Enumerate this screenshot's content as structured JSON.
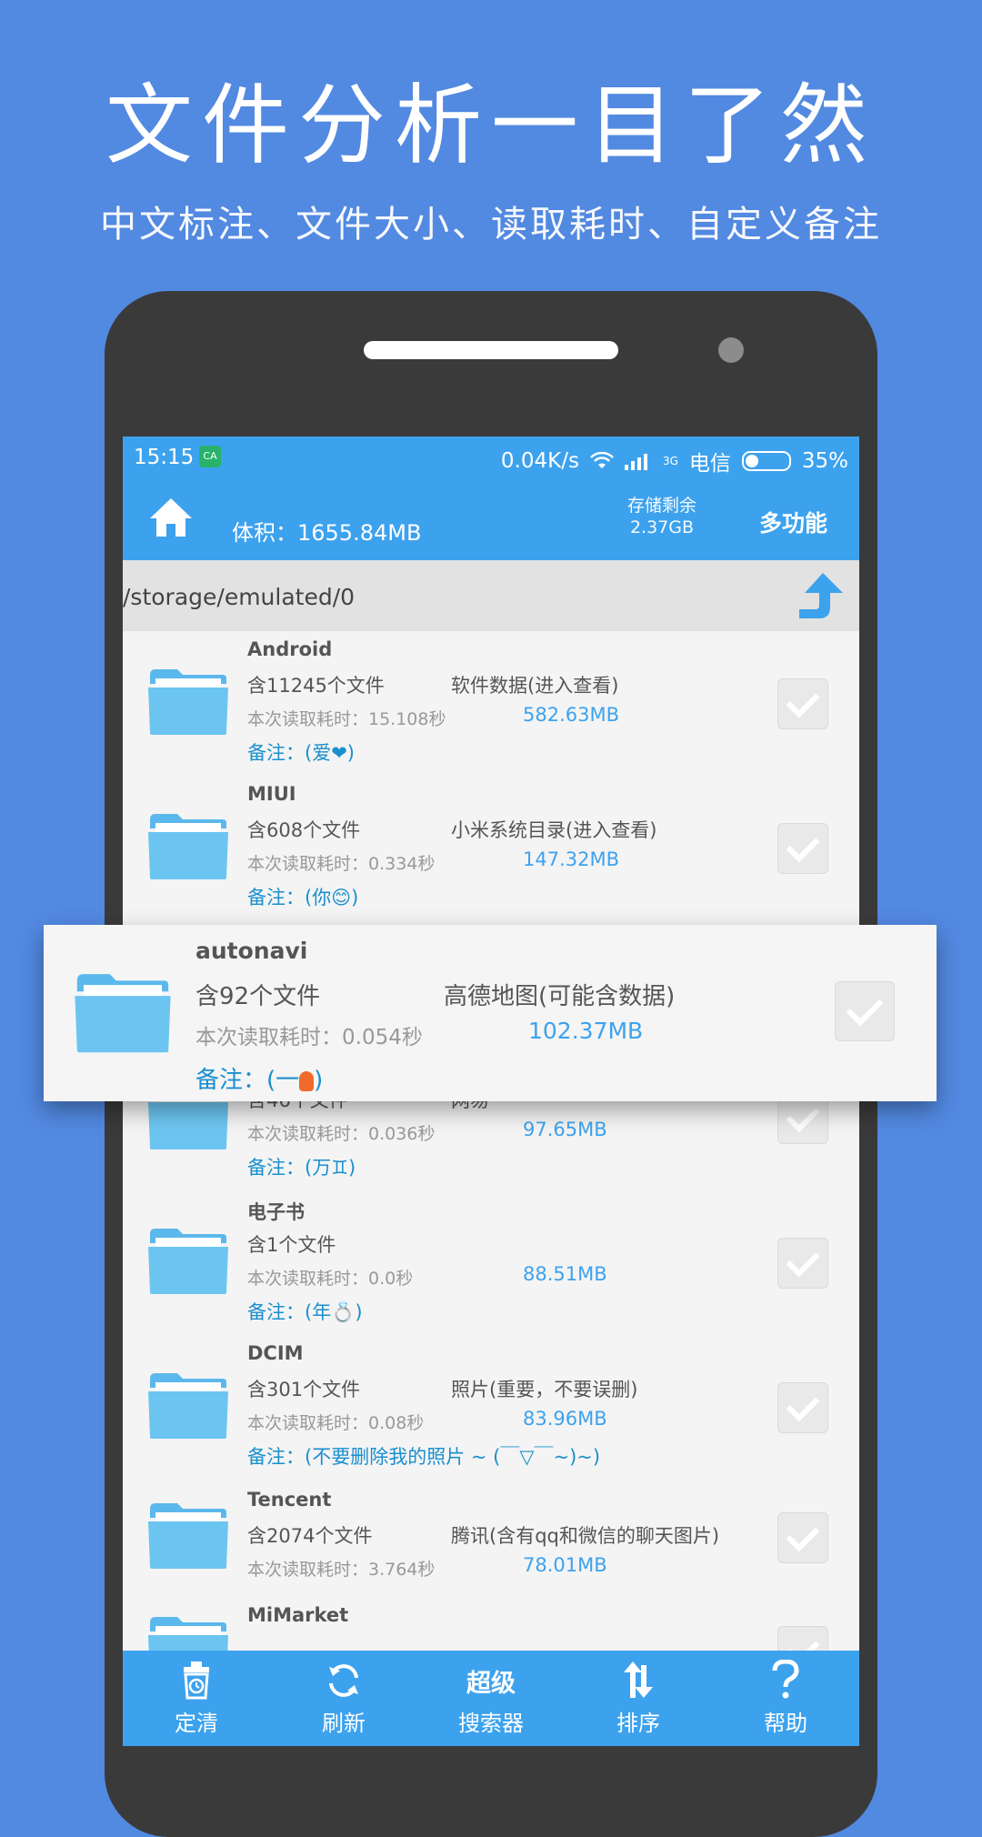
{
  "promo": {
    "title": "文件分析一目了然",
    "subtitle": "中文标注、文件大小、读取耗时、自定义备注"
  },
  "status_bar": {
    "time": "15:15",
    "app_badge": "CA",
    "speed": "0.04K/s",
    "network": "3G",
    "carrier": "电信",
    "battery": "35%"
  },
  "header": {
    "volume": "体积：1655.84MB",
    "storage_label": "存储剩余",
    "storage_value": "2.37GB",
    "multi_label": "多功能"
  },
  "path": "/storage/emulated/0",
  "rows": [
    {
      "name": "Android",
      "count": "含11245个文件",
      "desc": "软件数据(进入查看)",
      "time": "本次读取耗时：15.108秒",
      "size": "582.63MB",
      "note": "备注：(爱❤)"
    },
    {
      "name": "MIUI",
      "count": "含608个文件",
      "desc": "小米系统目录(进入查看)",
      "time": "本次读取耗时：0.334秒",
      "size": "147.32MB",
      "note": "备注：(你😊)"
    },
    {
      "name": "",
      "count": "含46个文件",
      "desc": "网易",
      "time": "本次读取耗时：0.036秒",
      "size": "97.65MB",
      "note": "备注：(万♊)"
    },
    {
      "name": "电子书",
      "count": "含1个文件",
      "desc": "",
      "time": "本次读取耗时：0.0秒",
      "size": "88.51MB",
      "note": "备注：(年💍)"
    },
    {
      "name": "DCIM",
      "count": "含301个文件",
      "desc": "照片(重要，不要误删)",
      "time": "本次读取耗时：0.08秒",
      "size": "83.96MB",
      "note": "备注：(不要删除我的照片 ~ (￣▽￣~)~)"
    },
    {
      "name": "Tencent",
      "count": "含2074个文件",
      "desc": "腾讯(含有qq和微信的聊天图片)",
      "time": "本次读取耗时：3.764秒",
      "size": "78.01MB",
      "note": ""
    },
    {
      "name": "MiMarket",
      "count": "",
      "desc": "",
      "time": "",
      "size": "",
      "note": ""
    }
  ],
  "popup": {
    "name": "autonavi",
    "count": "含92个文件",
    "desc": "高德地图(可能含数据)",
    "time": "本次读取耗时：0.054秒",
    "size": "102.37MB",
    "note_prefix": "备注：(一",
    "note_suffix": ")"
  },
  "bottom_bar": {
    "clean": "定清",
    "refresh": "刷新",
    "search_top": "超级",
    "search_bottom": "搜索器",
    "sort": "排序",
    "help": "帮助"
  }
}
